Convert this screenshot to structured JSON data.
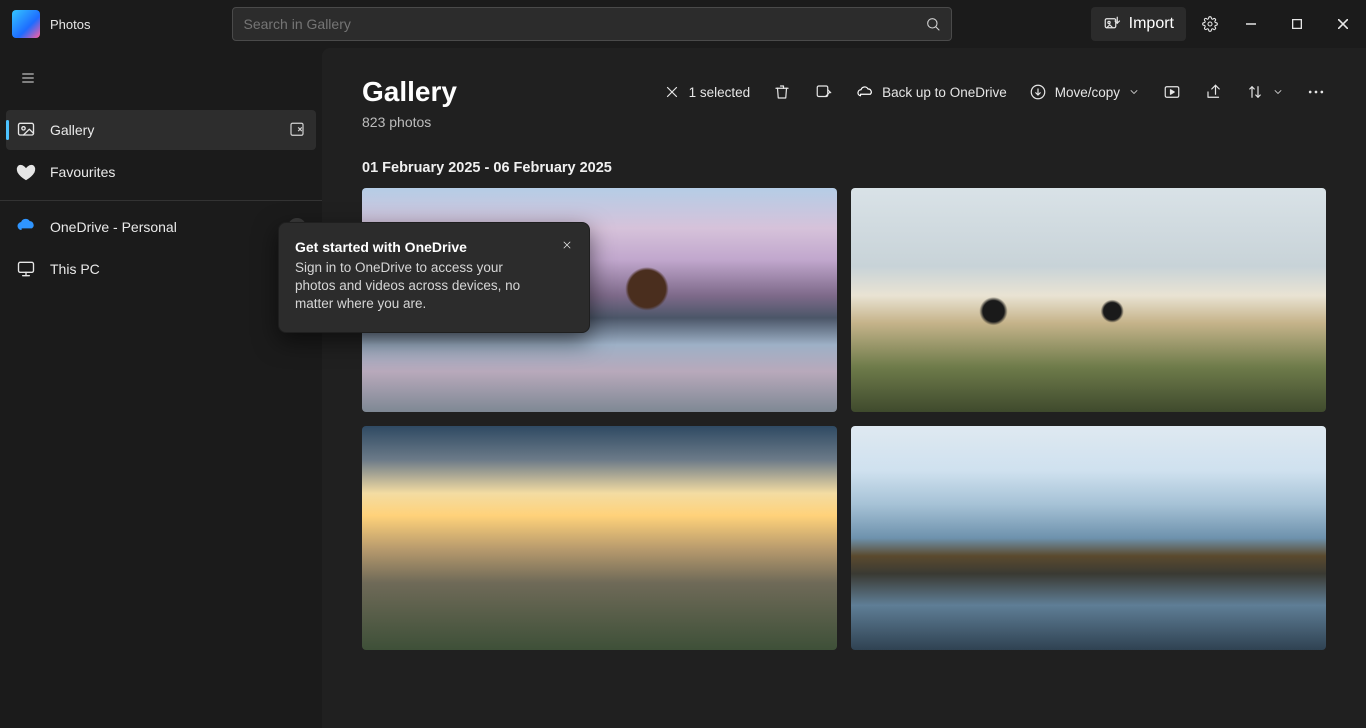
{
  "app": {
    "name": "Photos"
  },
  "search": {
    "placeholder": "Search in Gallery"
  },
  "titlebar": {
    "import_label": "Import"
  },
  "sidebar": {
    "items": [
      {
        "label": "Gallery"
      },
      {
        "label": "Favourites"
      },
      {
        "label": "OneDrive - Personal"
      },
      {
        "label": "This PC"
      }
    ]
  },
  "flyout": {
    "title": "Get started with OneDrive",
    "body": "Sign in to OneDrive to access your photos and videos across devices, no matter where you are."
  },
  "main": {
    "title": "Gallery",
    "subtitle": "823 photos",
    "selection_label": "1 selected",
    "backup_label": "Back up to OneDrive",
    "movecopy_label": "Move/copy",
    "date_range": "01 February 2025 - 06 February 2025"
  }
}
